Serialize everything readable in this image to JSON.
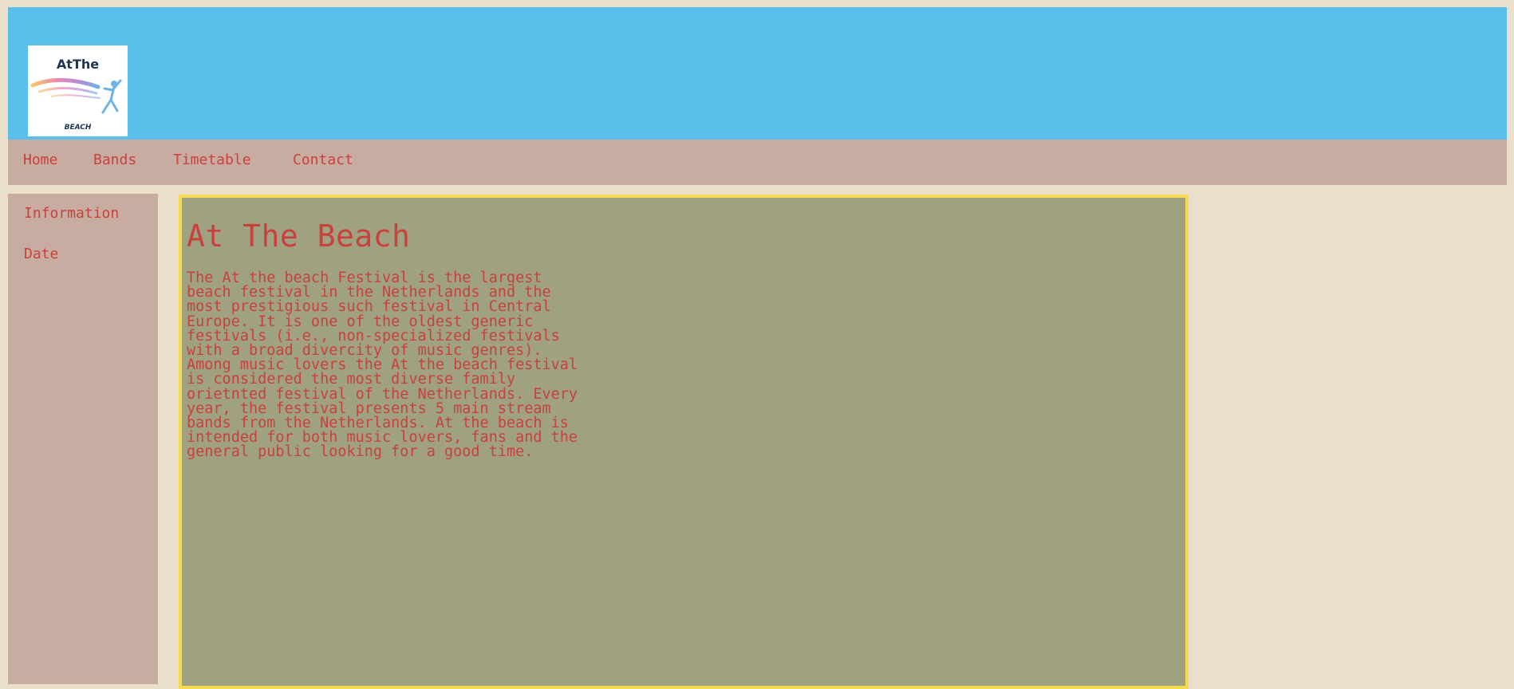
{
  "header": {
    "logo": {
      "text_top": "AtThe",
      "text_bottom": "BEACH"
    }
  },
  "topnav": {
    "items": [
      {
        "label": "Home"
      },
      {
        "label": "Bands"
      },
      {
        "label": "Timetable"
      },
      {
        "label": "Contact"
      }
    ]
  },
  "sidebar": {
    "items": [
      {
        "label": "Information"
      },
      {
        "label": "Date"
      }
    ]
  },
  "main": {
    "title": "At The Beach",
    "body": "The At the beach Festival is the largest beach festival in the Netherlands and the most prestigious such festival in Central Europe. It is one of the oldest generic festivals (i.e., non-specialized festivals with a broad divercity of music genres). Among music lovers the At the beach festival is considered the most diverse family orietnted festival of the Netherlands. Every year, the festival presents 5 main stream bands from the Netherlands. At the beach is intended for both music lovers, fans and the general public looking for a good time."
  },
  "colors": {
    "page_background": "#e9dfca",
    "header_background": "#5bbfeb",
    "nav_background": "#c9aca1",
    "main_background": "#9fa181",
    "main_border": "#f5dc4e",
    "text": "#c8413c"
  }
}
